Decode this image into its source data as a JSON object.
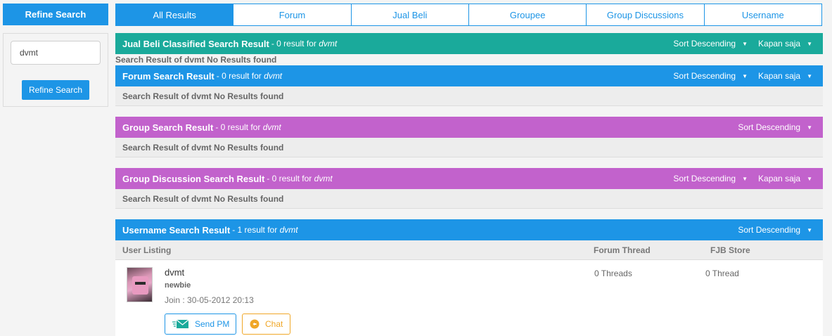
{
  "sidebar": {
    "title": "Refine Search",
    "search_value": "dvmt",
    "button_label": "Refine Search"
  },
  "tabs": [
    {
      "label": "All Results",
      "active": true
    },
    {
      "label": "Forum"
    },
    {
      "label": "Jual Beli"
    },
    {
      "label": "Groupee"
    },
    {
      "label": "Group Discussions"
    },
    {
      "label": "Username"
    }
  ],
  "sections": {
    "jualbeli": {
      "title": "Jual Beli Classified Search Result",
      "count_text": "- 0 result for",
      "query": "dvmt",
      "sort_label": "Sort Descending",
      "time_label": "Kapan saja",
      "no_result": "Search Result of dvmt No Results found"
    },
    "forum": {
      "title": "Forum Search Result",
      "count_text": "- 0 result for",
      "query": "dvmt",
      "sort_label": "Sort Descending",
      "time_label": "Kapan saja",
      "no_result": "Search Result of dvmt No Results found"
    },
    "group": {
      "title": "Group Search Result",
      "count_text": "- 0 result for",
      "query": "dvmt",
      "sort_label": "Sort Descending",
      "no_result": "Search Result of dvmt No Results found"
    },
    "groupdisc": {
      "title": "Group Discussion Search Result",
      "count_text": "- 0 result for",
      "query": "dvmt",
      "sort_label": "Sort Descending",
      "time_label": "Kapan saja",
      "no_result": "Search Result of dvmt No Results found"
    },
    "username": {
      "title": "Username Search Result",
      "count_text": "- 1 result for",
      "query": "dvmt",
      "sort_label": "Sort Descending",
      "columns": [
        "User Listing",
        "Forum Thread",
        "FJB Store"
      ],
      "users": [
        {
          "name": "dvmt",
          "rank": "newbie",
          "join": "Join : 30-05-2012 20:13",
          "threads": "0 Threads",
          "fjb": "0 Thread",
          "pm_label": "Send PM",
          "chat_label": "Chat"
        }
      ]
    }
  },
  "colors": {
    "blue": "#1d95e6",
    "teal": "#1aaa9b",
    "purple": "#c262cc",
    "orange": "#f0a727"
  },
  "icons": {
    "dropdown": "caret-down-icon",
    "pm": "send-pm-icon",
    "chat": "chat-icon"
  }
}
